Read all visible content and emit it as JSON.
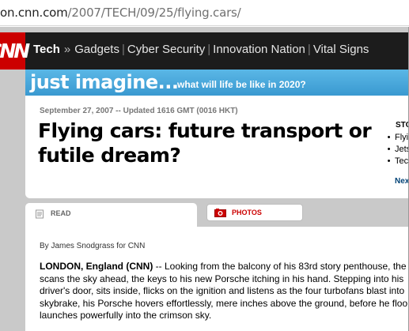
{
  "browser": {
    "url_prefix": "on.cnn.com",
    "url_path": "/2007/TECH/09/25/flying.cars/"
  },
  "header": {
    "logo_text": "CNN",
    "section": "Tech",
    "separator": "»",
    "nav_items": [
      "Gadgets",
      "Cyber Security",
      "Innovation Nation",
      "Vital Signs"
    ]
  },
  "banner": {
    "big": "just imagine...",
    "small": "what will life be like in 2020?"
  },
  "article": {
    "dateline": "September 27, 2007 -- Updated 1616 GMT (0016 HKT)",
    "headline_lines": [
      "Flying cars: future transport or",
      "futile dream?"
    ],
    "byline": "By James Snodgrass for CNN",
    "dateline_place": "LONDON, England (CNN)",
    "body_lines": [
      " -- Looking from the balcony of his 83rd story penthouse, the",
      "scans the sky ahead, the keys to his new Porsche itching in his hand. Stepping into his",
      "driver's door, sits inside, flicks on the ignition and listens as the four turbofans blast into",
      "skybrake, his Porsche hovers effortlessly, mere inches above the ground, before he floo",
      "launches powerfully into the crimson sky."
    ]
  },
  "highlights": {
    "header": "STO",
    "items": [
      "Flyi",
      "Jets",
      "Tec"
    ],
    "next": "Nex"
  },
  "tabs": {
    "read": "READ",
    "photos": "PHOTOS"
  },
  "colors": {
    "cnn_red": "#cc0000",
    "nav_bg": "#1c1c1c",
    "banner_blue": "#4aa8dd",
    "link_blue": "#004276"
  }
}
